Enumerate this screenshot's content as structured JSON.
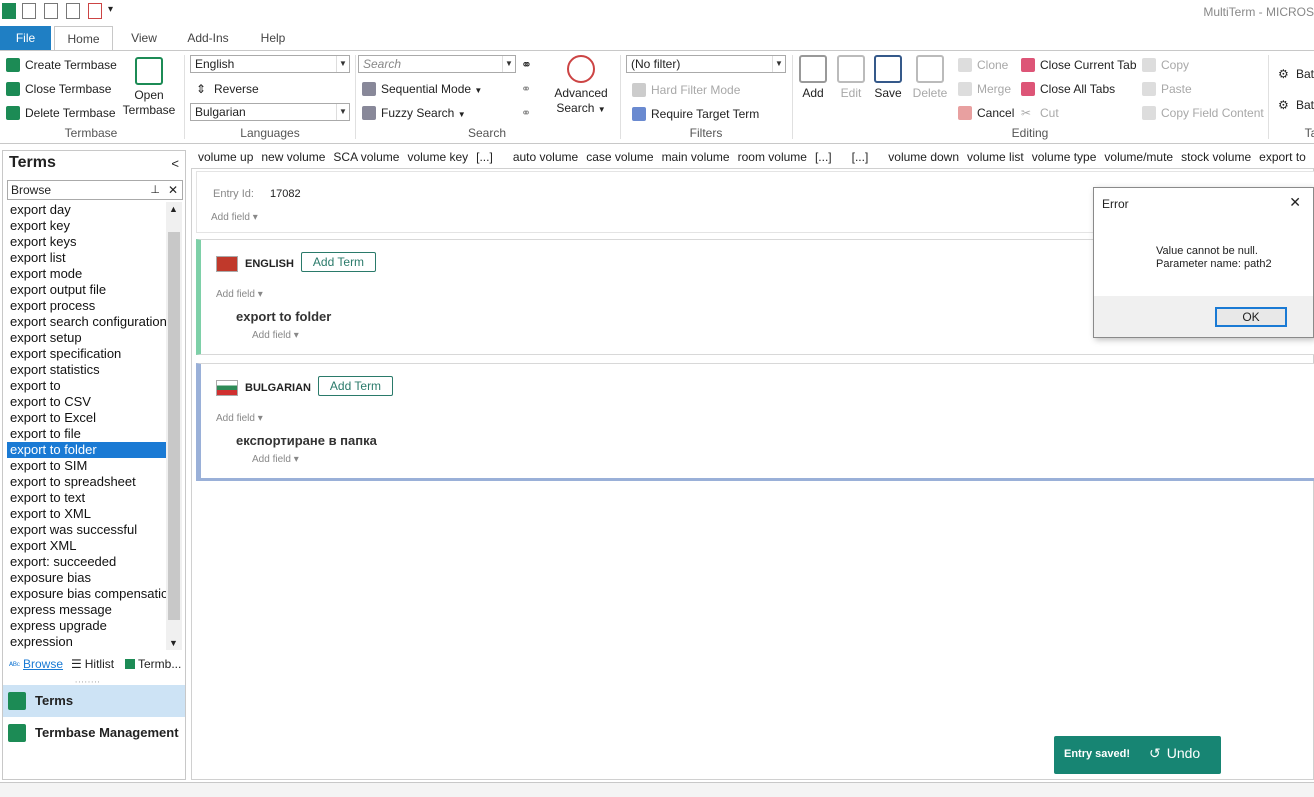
{
  "app": {
    "title": "MultiTerm - MICROS"
  },
  "ribbon_tabs": [
    "File",
    "Home",
    "View",
    "Add-Ins",
    "Help"
  ],
  "termbase_group": {
    "label": "Termbase",
    "create": "Create Termbase",
    "close": "Close Termbase",
    "delete": "Delete Termbase",
    "open_line1": "Open",
    "open_line2": "Termbase"
  },
  "languages_group": {
    "label": "Languages",
    "source": "English",
    "reverse": "Reverse",
    "target": "Bulgarian"
  },
  "search_group": {
    "label": "Search",
    "placeholder": "Search",
    "sequential": "Sequential Mode",
    "fuzzy": "Fuzzy Search",
    "advanced_line1": "Advanced",
    "advanced_line2": "Search"
  },
  "filters_group": {
    "label": "Filters",
    "filter_value": "(No filter)",
    "hard_filter": "Hard Filter Mode",
    "require_target": "Require Target Term"
  },
  "editing_group": {
    "label": "Editing",
    "add": "Add",
    "edit": "Edit",
    "save": "Save",
    "delete": "Delete",
    "clone": "Clone",
    "merge": "Merge",
    "cancel": "Cancel",
    "close_current_tab": "Close Current Tab",
    "close_all_tabs": "Close All Tabs",
    "cut": "Cut",
    "copy": "Copy",
    "paste": "Paste",
    "copy_field_content": "Copy Field Content"
  },
  "ribbon_right": {
    "bat1": "Bat",
    "bat2": "Bat",
    "ta": "Ta"
  },
  "left_panel": {
    "heading": "Terms",
    "collapse": "<",
    "browse_value": "Browse",
    "terms": [
      "export day",
      "export key",
      "export keys",
      "export list",
      "export mode",
      "export output file",
      "export process",
      "export search configuration",
      "export setup",
      "export specification",
      "export statistics",
      "export to",
      "export to CSV",
      "export to Excel",
      "export to file",
      "export to folder",
      "export to SIM",
      "export to spreadsheet",
      "export to text",
      "export to XML",
      "export was successful",
      "export XML",
      "export: succeeded",
      "exposure bias",
      "exposure bias compensation",
      "express message",
      "express upgrade",
      "expression"
    ],
    "selected_index": 15,
    "tabs": {
      "browse": "Browse",
      "hitlist": "Hitlist",
      "termbase": "Termb..."
    },
    "nav": {
      "terms": "Terms",
      "termbase_management": "Termbase Management"
    }
  },
  "field_bar": [
    "volume up",
    "new volume",
    "SCA volume",
    "volume key",
    "[...]",
    "auto volume",
    "case volume",
    "main volume",
    "room volume",
    "[...]",
    "[...]",
    "volume down",
    "volume list",
    "volume type",
    "volume/mute",
    "stock volume",
    "export to",
    "[...]",
    "[..."
  ],
  "entry": {
    "id_label": "Entry Id:",
    "id_value": "17082",
    "add_field": "Add field"
  },
  "english_section": {
    "language": "ENGLISH",
    "add_term": "Add Term",
    "add_field": "Add field",
    "term": "export to folder",
    "term_add_field": "Add field"
  },
  "bulgarian_section": {
    "language": "BULGARIAN",
    "add_term": "Add Term",
    "add_field": "Add field",
    "term": "експортиране в папка",
    "term_add_field": "Add field"
  },
  "error_dialog": {
    "title": "Error",
    "close": "✕",
    "line1": "Value cannot be null.",
    "line2": "Parameter name: path2",
    "ok": "OK"
  },
  "toast": {
    "message": "Entry saved!",
    "undo": "Undo"
  },
  "colors": {
    "file_tab": "#1f7fc4",
    "selection": "#1a7ad4",
    "english_accent": "#7ed0a8",
    "bulgarian_accent": "#9ab0d8",
    "toast": "#178573"
  }
}
